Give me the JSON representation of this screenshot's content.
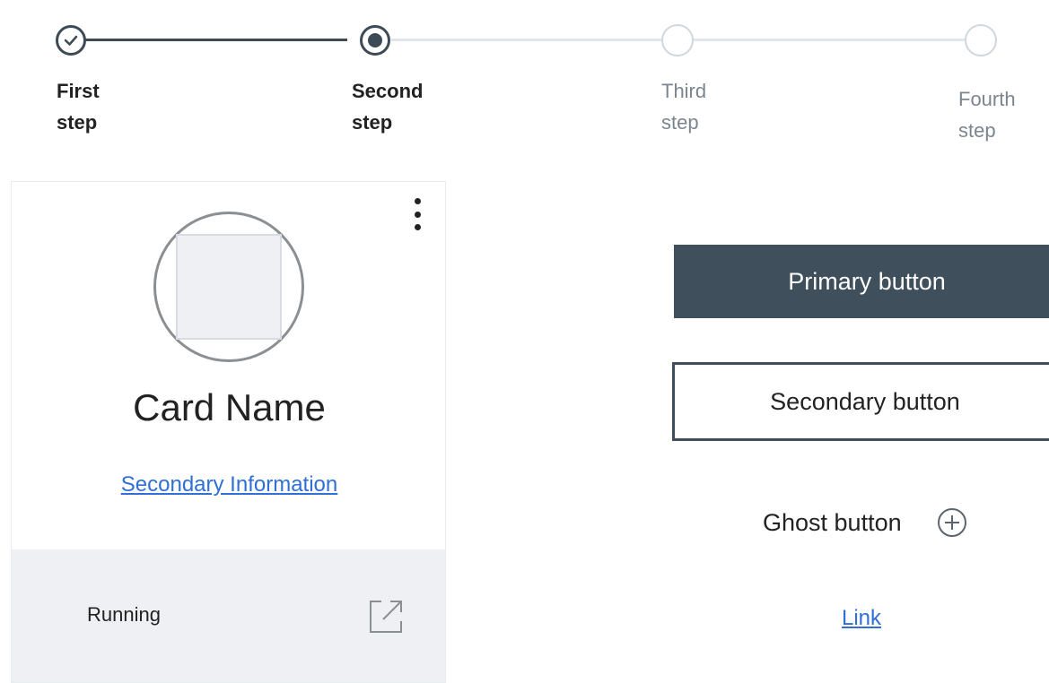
{
  "progress": {
    "steps": [
      {
        "line1": "First",
        "line2": "step",
        "state": "complete"
      },
      {
        "line1": "Second",
        "line2": "step",
        "state": "current"
      },
      {
        "line1": "Third",
        "line2": "step",
        "state": "incomplete"
      },
      {
        "line1": "Fourth",
        "line2": "step",
        "state": "incomplete"
      }
    ]
  },
  "card": {
    "name": "Card Name",
    "secondary_link": "Secondary Information",
    "status": "Running",
    "menu_icon": "overflow-menu-vertical-icon",
    "launch_icon": "launch-icon"
  },
  "buttons": {
    "primary": "Primary button",
    "secondary": "Secondary button",
    "ghost": "Ghost button",
    "ghost_icon": "add-circle-icon",
    "link": "Link"
  },
  "colors": {
    "primary": "#3f4f5c",
    "link": "#2f6fd6",
    "card_footer": "#eef0f3",
    "track_incomplete": "#dfe5ea"
  }
}
